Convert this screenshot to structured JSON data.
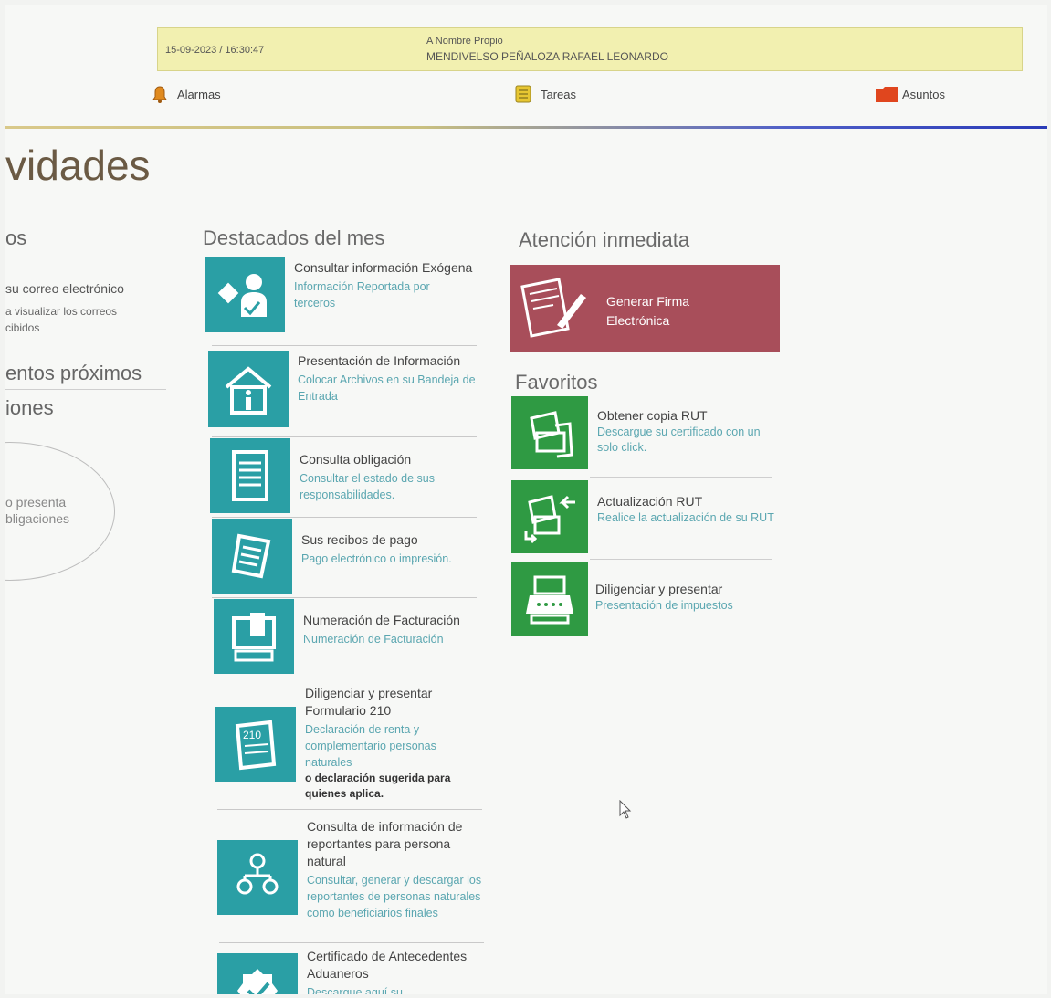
{
  "header": {
    "datetime": "15-09-2023 / 16:30:47",
    "mode_label": "A Nombre Propio",
    "user_name": "MENDIVELSO PEÑALOZA RAFAEL LEONARDO",
    "nav": [
      {
        "label": "Alarmas",
        "icon": "bell-icon"
      },
      {
        "label": "Tareas",
        "icon": "tasks-icon"
      },
      {
        "label": "Asuntos",
        "icon": "folder-icon"
      }
    ]
  },
  "page_title": "vidades",
  "left": {
    "heading_partial": "os",
    "mail_title": "su correo electrónico",
    "mail_sub1": "a visualizar los correos",
    "mail_sub2": "cibidos",
    "events_heading": "entos próximos",
    "obligations_heading": "iones",
    "circle_line1": "o presenta",
    "circle_line2": "bligaciones"
  },
  "destacados": {
    "heading": "Destacados del mes",
    "items": [
      {
        "title": "Consultar información Exógena",
        "sub": "Información Reportada por terceros",
        "icon": "exogena-icon"
      },
      {
        "title": "Presentación de Información",
        "sub": "Colocar Archivos en su Bandeja de Entrada",
        "icon": "house-info-icon"
      },
      {
        "title": "Consulta obligación",
        "sub": "Consultar el estado de sus responsabilidades.",
        "icon": "document-list-icon"
      },
      {
        "title": "Sus recibos de pago",
        "sub": "Pago electrónico o impresión.",
        "icon": "receipt-icon"
      },
      {
        "title": "Numeración de Facturación",
        "sub": "Numeración de Facturación",
        "icon": "invoice-terminal-icon"
      },
      {
        "title": "Diligenciar y presentar Formulario 210",
        "sub": "Declaración de renta y complementario personas naturales",
        "bold": "o declaración sugerida para quienes aplica.",
        "icon": "form-210-icon"
      },
      {
        "title": "Consulta de información de reportantes para persona natural",
        "sub": "Consultar, generar y descargar los reportantes de personas naturales como beneficiarios finales",
        "icon": "people-network-icon"
      },
      {
        "title": "Certificado de Antecedentes Aduaneros",
        "sub": "Descargue aquí su",
        "icon": "certificate-check-icon"
      }
    ]
  },
  "atencion": {
    "heading": "Atención inmediata",
    "button_label_1": "Generar Firma",
    "button_label_2": "Electrónica"
  },
  "favoritos": {
    "heading": "Favoritos",
    "items": [
      {
        "title": "Obtener copia RUT",
        "sub": "Descargue su certificado con un solo click.",
        "icon": "rut-copy-icon"
      },
      {
        "title": "Actualización RUT",
        "sub": "Realice la actualización de su RUT",
        "icon": "rut-update-icon"
      },
      {
        "title": "Diligenciar y presentar",
        "sub": "Presentación de impuestos",
        "icon": "tax-present-icon"
      }
    ]
  },
  "colors": {
    "teal": "#2a9fa5",
    "green": "#2f9a43",
    "red": "#a84e5a",
    "header_yellow": "#f2f0b0"
  }
}
